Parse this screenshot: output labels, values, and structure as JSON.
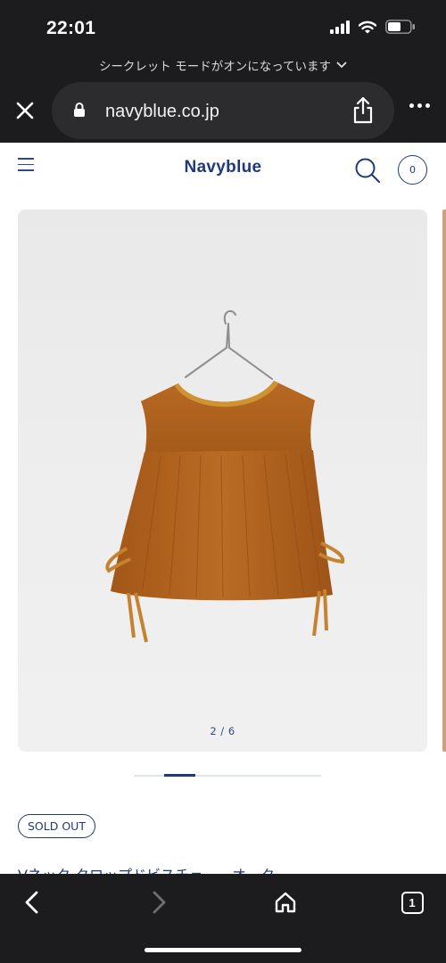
{
  "status_bar": {
    "time": "22:01"
  },
  "browser": {
    "incognito_notice": "シークレット モードがオンになっています",
    "url": "navyblue.co.jp",
    "open_tabs": "1"
  },
  "site": {
    "brand": "Navyblue",
    "cart_count": "0"
  },
  "product": {
    "image_counter": "2 / 6",
    "gallery_progress": {
      "current": 2,
      "total": 6
    },
    "badge": "SOLD OUT",
    "title": "Vネック クロップドビスチェ　　オーク"
  },
  "colors": {
    "browser_chrome": "#1c1c1e",
    "url_pill": "#2c2c2e",
    "brand_navy": "#1f3a78",
    "garment": "#b0641f"
  },
  "icons": [
    "signal-icon",
    "wifi-icon",
    "battery-icon",
    "chevron-down-icon",
    "close-icon",
    "lock-icon",
    "share-icon",
    "more-icon",
    "menu-icon",
    "search-icon",
    "back-icon",
    "forward-icon",
    "home-icon"
  ]
}
